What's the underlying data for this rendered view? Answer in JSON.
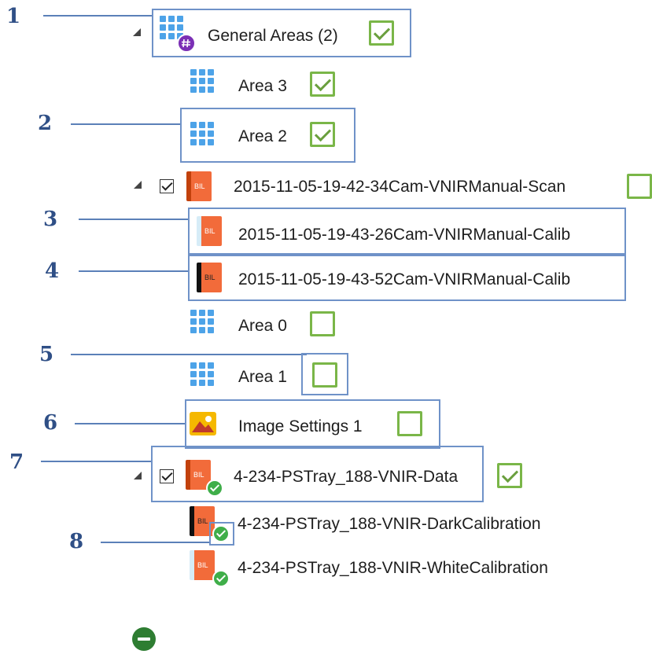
{
  "callouts": [
    "1",
    "2",
    "3",
    "4",
    "5",
    "6",
    "7",
    "8"
  ],
  "tree": {
    "general_areas": {
      "label": "General Areas (2)",
      "checked": true,
      "icon": "grid-hash-icon"
    },
    "area3": {
      "label": "Area 3",
      "checked": true
    },
    "area2": {
      "label": "Area 2",
      "checked": true
    },
    "scan": {
      "label": "2015-11-05-19-42-34Cam-VNIRManual-Scan",
      "checked": false
    },
    "calib_white": {
      "label": "2015-11-05-19-43-26Cam-VNIRManual-Calib"
    },
    "calib_dark": {
      "label": "2015-11-05-19-43-52Cam-VNIRManual-Calib"
    },
    "area0": {
      "label": "Area 0",
      "checked": false
    },
    "area1": {
      "label": "Area 1",
      "checked": false
    },
    "image_settings": {
      "label": "Image Settings 1",
      "checked": false
    },
    "data": {
      "label": "4-234-PSTray_188-VNIR-Data",
      "checked": true
    },
    "dark": {
      "label": "4-234-PSTray_188-VNIR-DarkCalibration"
    },
    "white": {
      "label": "4-234-PSTray_188-VNIR-WhiteCalibration"
    }
  },
  "bil_text": "BIL",
  "colors": {
    "accent_green": "#7ab648",
    "callout_blue": "#6f92c8",
    "grid_blue": "#4da3e8",
    "bil_orange": "#f26b3a"
  }
}
